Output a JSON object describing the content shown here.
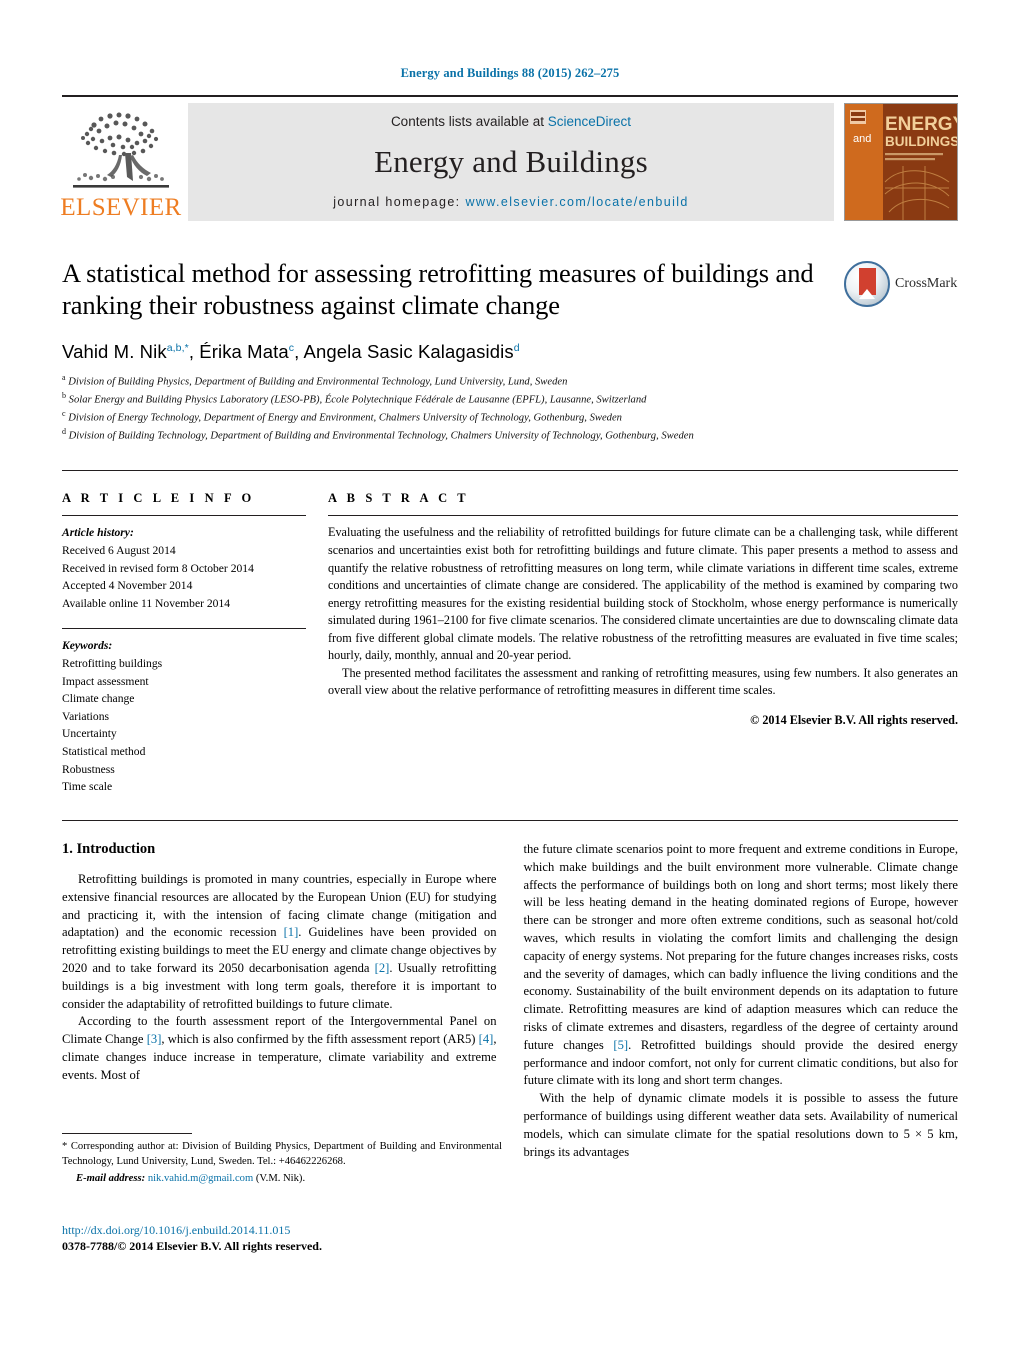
{
  "running_head": "Energy and Buildings 88 (2015) 262–275",
  "masthead": {
    "publisher_logo_label": "ELSEVIER",
    "contents_prefix": "Contents lists available at ",
    "sciencedirect": "ScienceDirect",
    "journal_name": "Energy and Buildings",
    "homepage_prefix": "journal homepage: ",
    "homepage_url": "www.elsevier.com/locate/enbuild",
    "cover_and": "and",
    "cover_energy": "ENERGY",
    "cover_buildings": "BUILDINGS"
  },
  "article": {
    "title": "A statistical method for assessing retrofitting measures of buildings and ranking their robustness against climate change",
    "crossmark_label": "CrossMark",
    "authors_html": "Vahid M. Nik<sup>a,b,</sup><sup>*</sup>, Érika Mata<sup>c</sup>, Angela Sasic Kalagasidis<sup>d</sup>",
    "affiliations": [
      {
        "marker": "a",
        "text": "Division of Building Physics, Department of Building and Environmental Technology, Lund University, Lund, Sweden"
      },
      {
        "marker": "b",
        "text": "Solar Energy and Building Physics Laboratory (LESO-PB), École Polytechnique Fédérale de Lausanne (EPFL), Lausanne, Switzerland"
      },
      {
        "marker": "c",
        "text": "Division of Energy Technology, Department of Energy and Environment, Chalmers University of Technology, Gothenburg, Sweden"
      },
      {
        "marker": "d",
        "text": "Division of Building Technology, Department of Building and Environmental Technology, Chalmers University of Technology, Gothenburg, Sweden"
      }
    ]
  },
  "article_info": {
    "heading": "A R T I C L E   I N F O",
    "history_label": "Article history:",
    "history": [
      "Received 6 August 2014",
      "Received in revised form 8 October 2014",
      "Accepted 4 November 2014",
      "Available online 11 November 2014"
    ],
    "keywords_label": "Keywords:",
    "keywords": [
      "Retrofitting buildings",
      "Impact assessment",
      "Climate change",
      "Variations",
      "Uncertainty",
      "Statistical method",
      "Robustness",
      "Time scale"
    ]
  },
  "abstract": {
    "heading": "A B S T R A C T",
    "paragraph_1": "Evaluating the usefulness and the reliability of retrofitted buildings for future climate can be a challenging task, while different scenarios and uncertainties exist both for retrofitting buildings and future climate. This paper presents a method to assess and quantify the relative robustness of retrofitting measures on long term, while climate variations in different time scales, extreme conditions and uncertainties of climate change are considered. The applicability of the method is examined by comparing two energy retrofitting measures for the existing residential building stock of Stockholm, whose energy performance is numerically simulated during 1961–2100 for five climate scenarios. The considered climate uncertainties are due to downscaling climate data from five different global climate models. The relative robustness of the retrofitting measures are evaluated in five time scales; hourly, daily, monthly, annual and 20-year period.",
    "paragraph_2": "The presented method facilitates the assessment and ranking of retrofitting measures, using few numbers. It also generates an overall view about the relative performance of retrofitting measures in different time scales.",
    "copyright": "© 2014 Elsevier B.V. All rights reserved."
  },
  "body": {
    "section_1_heading": "1.  Introduction",
    "left_paragraph_1": "Retrofitting buildings is promoted in many countries, especially in Europe where extensive financial resources are allocated by the European Union (EU) for studying and practicing it, with the intension of facing climate change (mitigation and adaptation) and the economic recession ",
    "left_ref_1": "[1]",
    "left_paragraph_1b": ". Guidelines have been provided on retrofitting existing buildings to meet the EU energy and climate change objectives by 2020 and to take forward its 2050 decarbonisation agenda ",
    "left_ref_2": "[2]",
    "left_paragraph_1c": ". Usually retrofitting buildings is a big investment with long term goals, therefore it is important to consider the adaptability of retrofitted buildings to future climate.",
    "left_paragraph_2": "According to the fourth assessment report of the Intergovernmental Panel on Climate Change ",
    "left_ref_3": "[3]",
    "left_paragraph_2b": ", which is also confirmed by the fifth assessment report (AR5) ",
    "left_ref_4": "[4]",
    "left_paragraph_2c": ", climate changes induce increase in temperature, climate variability and extreme events. Most of",
    "right_paragraph_1": "the future climate scenarios point to more frequent and extreme conditions in Europe, which make buildings and the built environment more vulnerable. Climate change affects the performance of buildings both on long and short terms; most likely there will be less heating demand in the heating dominated regions of Europe, however there can be stronger and more often extreme conditions, such as seasonal hot/cold waves, which results in violating the comfort limits and challenging the design capacity of energy systems. Not preparing for the future changes increases risks, costs and the severity of damages, which can badly influence the living conditions and the economy. Sustainability of the built environment depends on its adaptation to future climate. Retrofitting measures are kind of adaption measures which can reduce the risks of climate extremes and disasters, regardless of the degree of certainty around future changes ",
    "right_ref_5": "[5]",
    "right_paragraph_1b": ". Retrofitted buildings should provide the desired energy performance and indoor comfort, not only for current climatic conditions, but also for future climate with its long and short term changes.",
    "right_paragraph_2": "With the help of dynamic climate models it is possible to assess the future performance of buildings using different weather data sets. Availability of numerical models, which can simulate climate for the spatial resolutions down to 5 × 5 km, brings its advantages"
  },
  "footnotes": {
    "corresponding": "* Corresponding author at: Division of Building Physics, Department of Building and Environmental Technology, Lund University, Lund, Sweden. Tel.: +46462226268.",
    "email_label": "E-mail address:",
    "email": "nik.vahid.m@gmail.com",
    "email_suffix": "(V.M. Nik).",
    "doi": "http://dx.doi.org/10.1016/j.enbuild.2014.11.015",
    "issn": "0378-7788/© 2014 Elsevier B.V. All rights reserved."
  },
  "colors": {
    "link": "#0a72a8",
    "elsevier_orange": "#ee7d22",
    "band_gray": "#e6e6e6",
    "cover_orange": "#d2661c",
    "cover_dark": "#8e3b12"
  }
}
